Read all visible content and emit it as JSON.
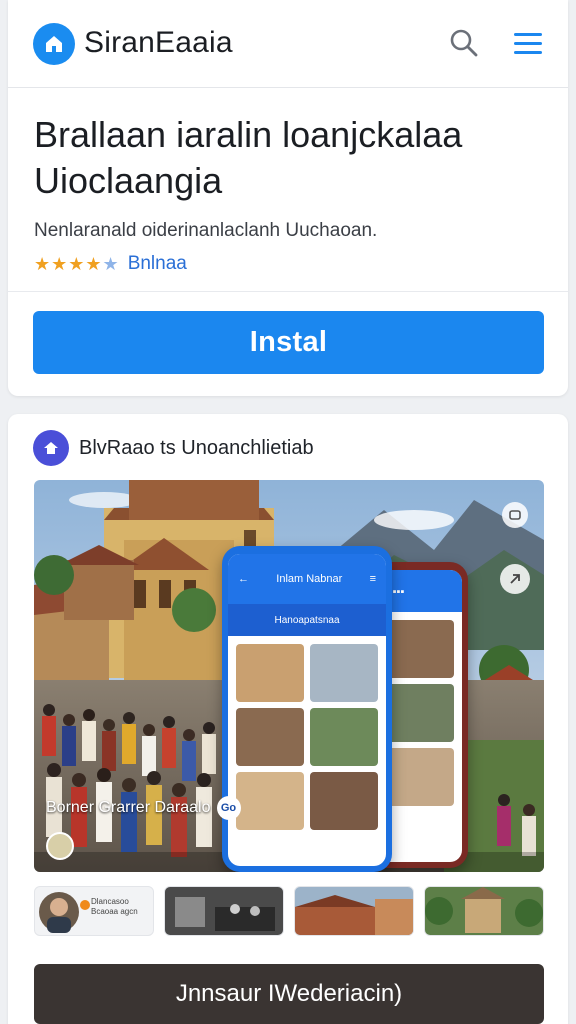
{
  "header": {
    "app_name": "SiranEaaia",
    "logo_icon": "home-icon",
    "search_icon": "search-icon",
    "menu_icon": "hamburger-menu-icon"
  },
  "app": {
    "title": "Brallaan iaralin loanjckalaa Uioclaangia",
    "subtitle": "Nenlaranald oiderinanlaclanh Uuchaoan.",
    "rating": {
      "stars": 4.5,
      "label": "Bnlnaa"
    },
    "install_label": "Instal"
  },
  "developer": {
    "name": "BlvRaao ts Unoanchlietiab",
    "icon": "developer-badge-icon"
  },
  "screenshot": {
    "caption": "Borner Grarrer Daraalo",
    "caption_badge": "Go",
    "phone_header": "Inlam Nabnar",
    "phone_banner": "Hanoapatsnaa"
  },
  "thumbnails": [
    {
      "name": "profile-thumb",
      "caption": "Dlancasoo Bcaoaa agcn"
    },
    {
      "name": "market-thumb",
      "caption": ""
    },
    {
      "name": "village-thumb",
      "caption": ""
    },
    {
      "name": "temple-thumb",
      "caption": ""
    }
  ],
  "cta_label": "Jnnsaur IWederiacin)",
  "colors": {
    "accent": "#1b87ef",
    "star": "#f0a020",
    "cta_dark": "#3a3432",
    "developer_badge": "#4a4fd8"
  }
}
